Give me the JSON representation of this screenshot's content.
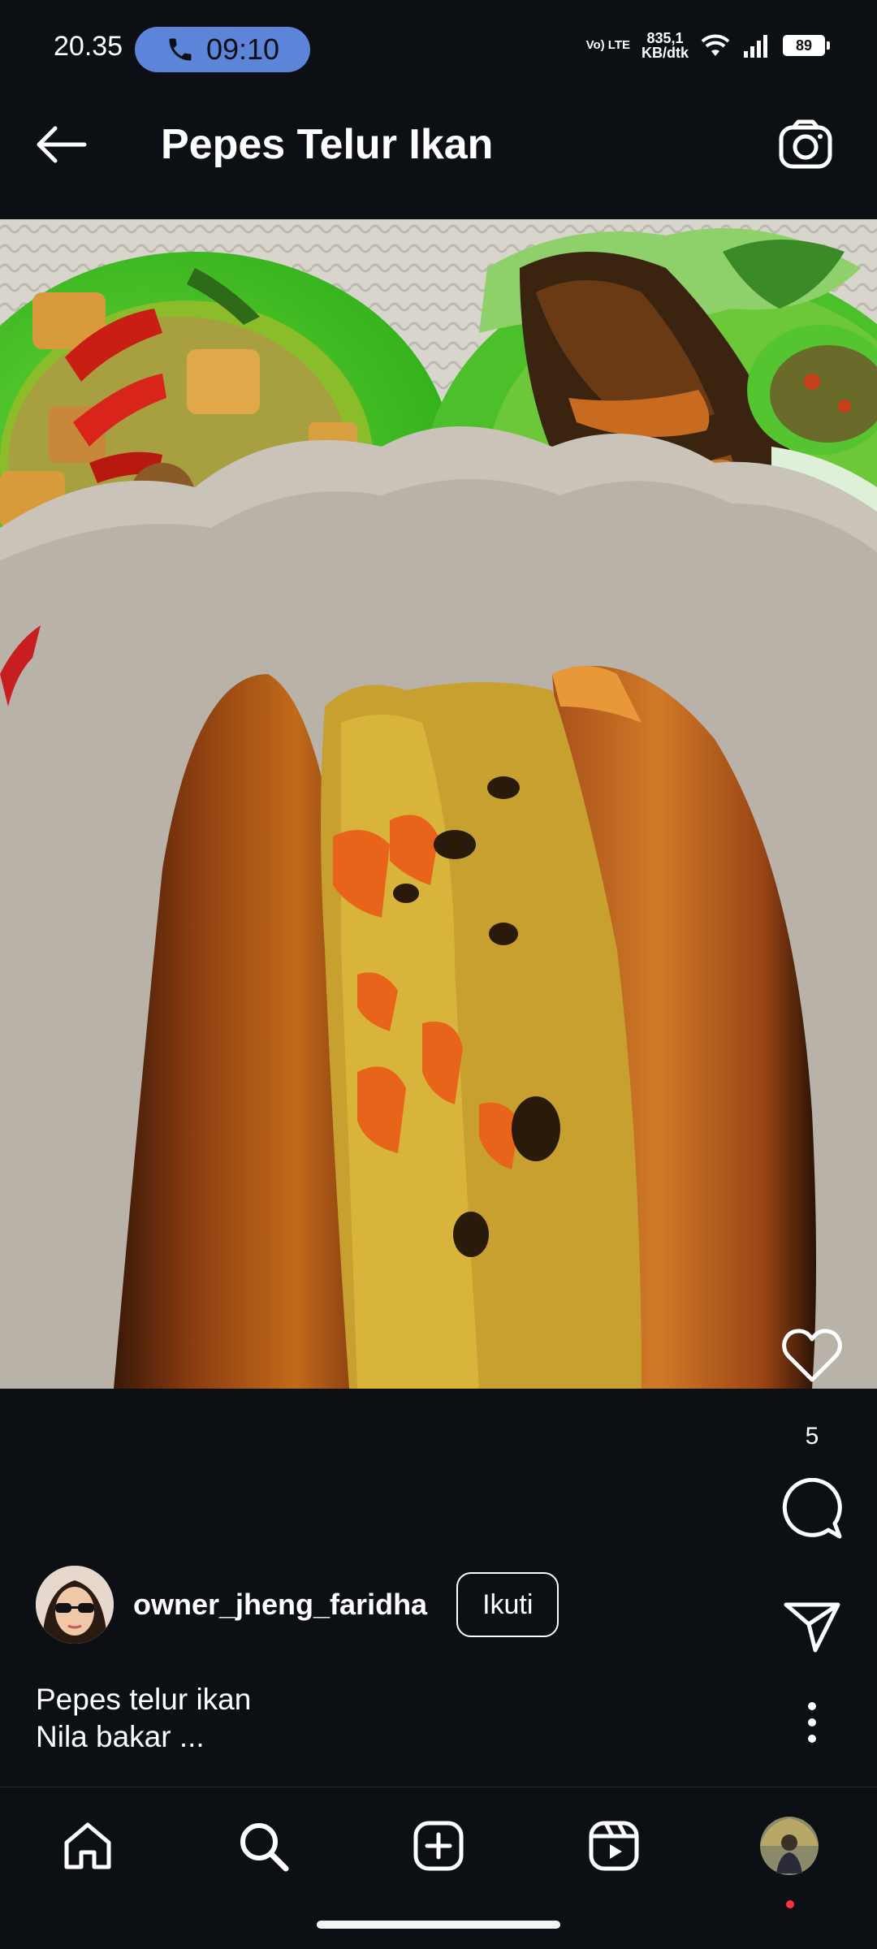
{
  "status_bar": {
    "time": "20.35",
    "call_timer": "09:10",
    "network_top": "Vo) LTE",
    "speed_value": "835,1",
    "speed_unit": "KB/dtk",
    "battery": "89"
  },
  "header": {
    "title": "Pepes Telur Ikan"
  },
  "post": {
    "likes": "5",
    "username": "owner_jheng_faridha",
    "follow_label": "Ikuti",
    "caption_line1": "Pepes telur ikan",
    "caption_line2": "Nila bakar ..."
  },
  "colors": {
    "background": "#0c1014",
    "call_pill": "#5c84d8",
    "notification_dot": "#ff3040"
  },
  "icons": {
    "back": "arrow-left-icon",
    "camera": "camera-icon",
    "like": "heart-icon",
    "comment": "comment-icon",
    "share": "paper-plane-icon",
    "more": "more-vertical-icon",
    "nav": [
      "home-icon",
      "search-icon",
      "create-icon",
      "reels-icon",
      "profile-avatar"
    ]
  }
}
